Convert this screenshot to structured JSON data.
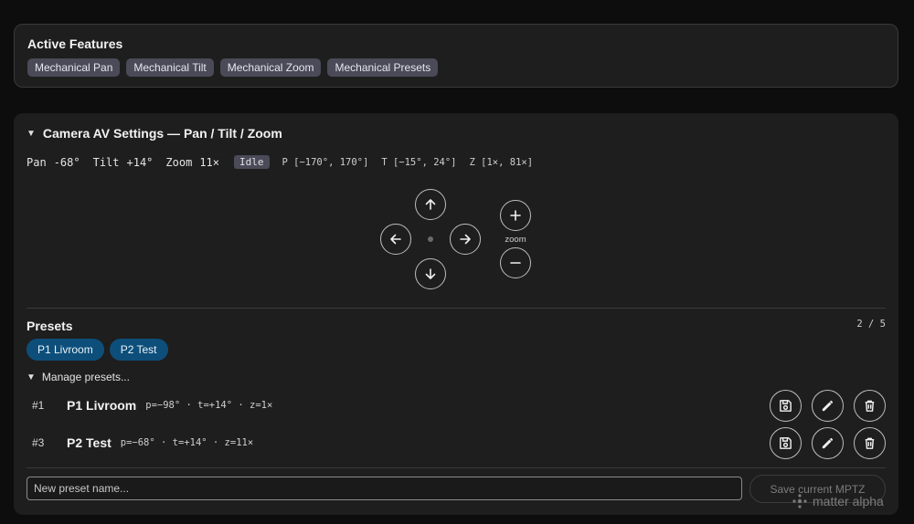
{
  "features": {
    "title": "Active Features",
    "chips": [
      "Mechanical Pan",
      "Mechanical Tilt",
      "Mechanical Zoom",
      "Mechanical Presets"
    ]
  },
  "camera": {
    "title": "Camera AV Settings — Pan / Tilt / Zoom",
    "status": {
      "pan_label": "Pan",
      "pan_value": "-68°",
      "tilt_label": "Tilt",
      "tilt_value": "+14°",
      "zoom_label": "Zoom",
      "zoom_value": "11×",
      "state": "Idle",
      "pan_range": "P [−170°, 170°]",
      "tilt_range": "T [−15°, 24°]",
      "zoom_range": "Z [1×, 81×]"
    },
    "zoom_caption": "zoom"
  },
  "presets": {
    "title": "Presets",
    "count": "2 / 5",
    "chips": [
      "P1 Livroom",
      "P2 Test"
    ],
    "manage_label": "Manage presets...",
    "rows": [
      {
        "num": "#1",
        "name": "P1 Livroom",
        "values": "p=−98° · t=+14° · z=1×"
      },
      {
        "num": "#3",
        "name": "P2 Test",
        "values": "p=−68° · t=+14° · z=11×"
      }
    ],
    "input_placeholder": "New preset name...",
    "save_label": "Save current MPTZ"
  },
  "watermark": "matter alpha",
  "icons": {
    "up": "arrow-up-icon",
    "down": "arrow-down-icon",
    "left": "arrow-left-icon",
    "right": "arrow-right-icon",
    "zoom_in": "plus-icon",
    "zoom_out": "minus-icon",
    "save": "floppy-disk-icon",
    "edit": "pencil-icon",
    "delete": "trash-icon"
  },
  "colors": {
    "accent": "#0d4f7a",
    "chip": "#4a4a58",
    "card": "#1e1e1e",
    "background": "#0d0d0d"
  }
}
